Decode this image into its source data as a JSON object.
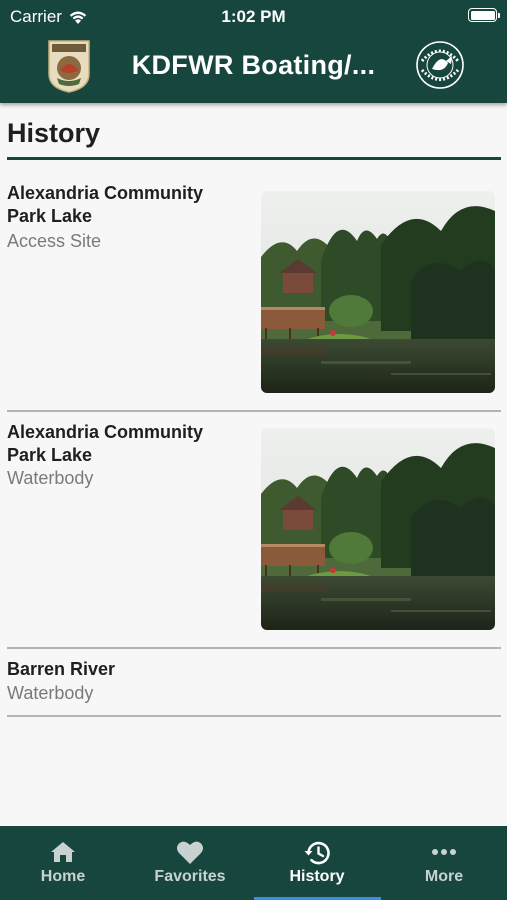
{
  "status_bar": {
    "carrier": "Carrier",
    "time": "1:02 PM"
  },
  "header": {
    "title": "KDFWR Boating/...",
    "left_logo": "kentucky-fish-wildlife-logo",
    "right_logo": "sport-fish-restoration-logo",
    "background": "#17463f"
  },
  "page": {
    "title": "History"
  },
  "history": [
    {
      "name": "Alexandria Community Park Lake",
      "type": "Access Site",
      "has_image": true
    },
    {
      "name": "Alexandria Community Park Lake",
      "type": "Waterbody",
      "has_image": true
    },
    {
      "name": "Barren River",
      "type": "Waterbody",
      "has_image": false
    }
  ],
  "tabbar": {
    "tabs": [
      {
        "label": "Home",
        "icon": "home-icon",
        "active": false
      },
      {
        "label": "Favorites",
        "icon": "heart-icon",
        "active": false
      },
      {
        "label": "History",
        "icon": "history-icon",
        "active": true
      },
      {
        "label": "More",
        "icon": "more-icon",
        "active": false
      }
    ],
    "accent": "#3b8fe0"
  }
}
